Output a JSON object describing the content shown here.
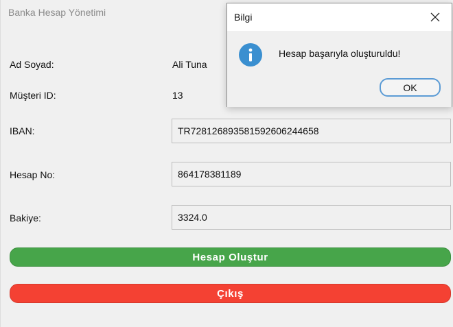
{
  "window": {
    "title": "Banka Hesap Yönetimi"
  },
  "form": {
    "name_label": "Ad Soyad:",
    "name_value": "Ali Tuna",
    "customer_id_label": "Müşteri ID:",
    "customer_id_value": "13",
    "iban_label": "IBAN:",
    "iban_value": "TR7281268935815926062446​58",
    "account_no_label": "Hesap No:",
    "account_no_value": "864178381189",
    "balance_label": "Bakiye:",
    "balance_value": "3324.0"
  },
  "buttons": {
    "create_label": "Hesap Oluştur",
    "exit_label": "Çıkış",
    "create_color": "#47a54a",
    "exit_color": "#f44133"
  },
  "dialog": {
    "title": "Bilgi",
    "message": "Hesap başarıyla oluşturuldu!",
    "ok_label": "OK",
    "icon": "info-icon",
    "icon_color": "#3a8fd0"
  }
}
